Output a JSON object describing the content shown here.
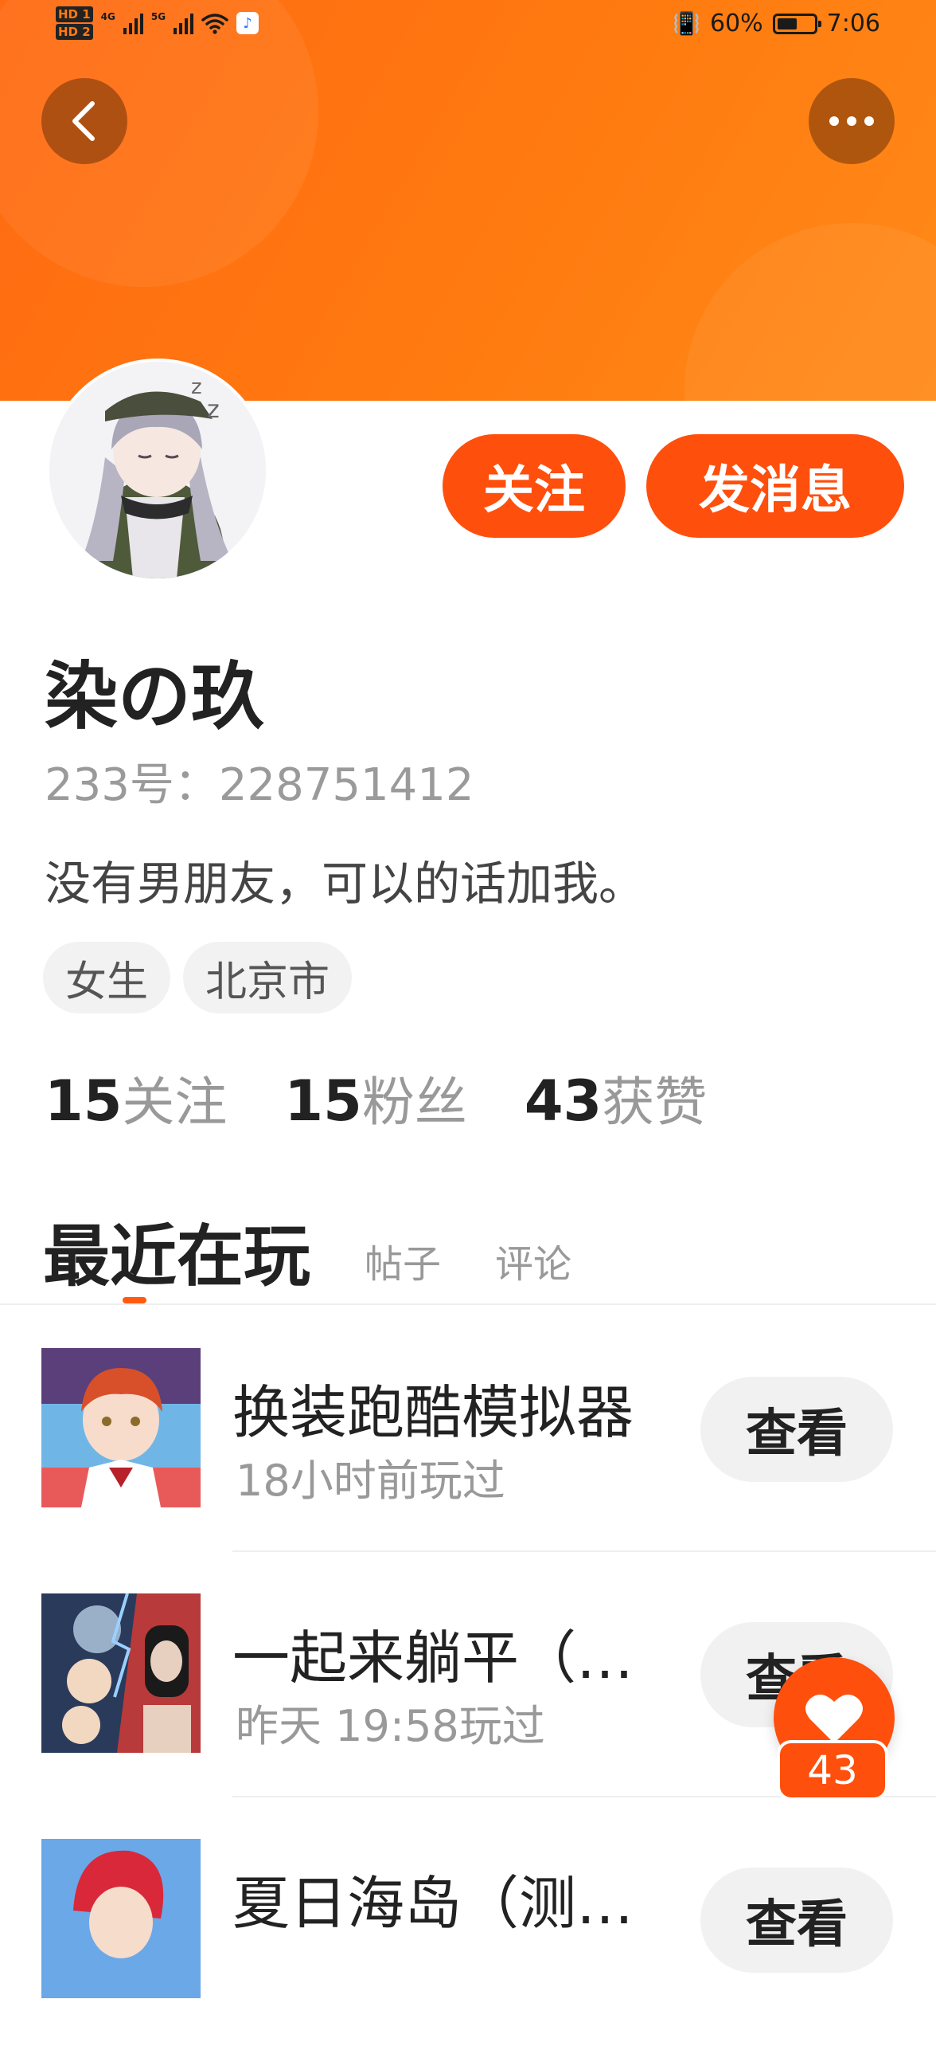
{
  "status_bar": {
    "hd1": "HD 1",
    "hd2": "HD 2",
    "net1": "4G",
    "net2": "5G",
    "battery_pct": "60%",
    "battery_level": 0.6,
    "time": "7:06"
  },
  "header": {
    "back_icon": "chevron-left-icon",
    "more_icon": "more-dots-icon",
    "accent_color": "#ff6a12"
  },
  "profile": {
    "nickname": "染の玖",
    "user_id": "233号：228751412",
    "bio": "没有男朋友，可以的话加我。",
    "tags": [
      "女生",
      "北京市"
    ],
    "follow_label": "关注",
    "message_label": "发消息"
  },
  "stats": [
    {
      "num": "15",
      "label": "关注"
    },
    {
      "num": "15",
      "label": "粉丝"
    },
    {
      "num": "43",
      "label": "获赞"
    }
  ],
  "tabs": {
    "active": "最近在玩",
    "items": [
      "帖子",
      "评论"
    ]
  },
  "games": [
    {
      "title": "换装跑酷模拟器",
      "time": "18小时前玩过",
      "button": "查看"
    },
    {
      "title": "一起来躺平（…",
      "time": "昨天 19:58玩过",
      "button": "查看"
    },
    {
      "title": "夏日海岛（测…",
      "time": "",
      "button": "查看"
    }
  ],
  "like": {
    "icon": "heart-icon",
    "count": "43"
  }
}
